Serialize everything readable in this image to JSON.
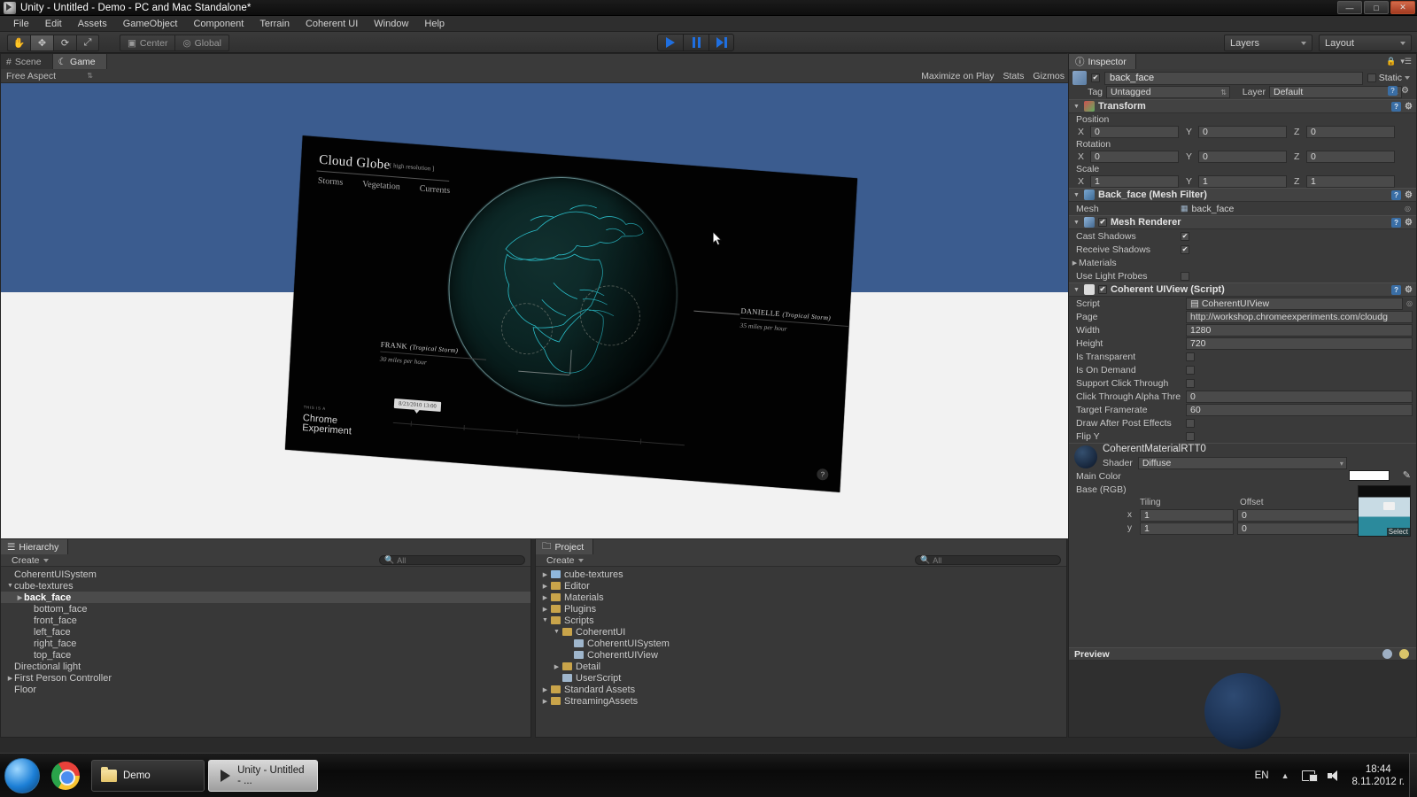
{
  "window": {
    "title": "Unity - Untitled - Demo - PC and Mac Standalone*",
    "minimize": "—",
    "maximize": "□",
    "close": "✕"
  },
  "menu": [
    "File",
    "Edit",
    "Assets",
    "GameObject",
    "Component",
    "Terrain",
    "Coherent UI",
    "Window",
    "Help"
  ],
  "toolbar": {
    "tools": [
      "hand-tool",
      "move-tool",
      "rotate-tool",
      "scale-tool"
    ],
    "pivot": "Center",
    "handle": "Global",
    "play": "play-button",
    "pause": "pause-button",
    "step": "step-button",
    "layers": "Layers",
    "layout": "Layout"
  },
  "gameview": {
    "tabs": [
      {
        "label": "Scene",
        "active": false
      },
      {
        "label": "Game",
        "active": true
      }
    ],
    "aspect": "Free Aspect",
    "maximize_on_play": "Maximize on Play",
    "stats": "Stats",
    "gizmos": "Gizmos"
  },
  "cloudglobe": {
    "title": "Cloud Globe",
    "resolution_tag": "[ high resolution ]",
    "nav": [
      "Storms",
      "Vegetation",
      "Currents"
    ],
    "storms": [
      {
        "name": "DANIELLE",
        "type": "(Tropical Storm)",
        "speed": "35 miles per hour"
      },
      {
        "name": "FRANK",
        "type": "(Tropical Storm)",
        "speed": "30 miles per hour"
      }
    ],
    "timestamp": "8/23/2010 13:00",
    "chrome_small": "THIS IS A",
    "chrome_line1": "Chrome",
    "chrome_line2": "Experiment",
    "help": "?"
  },
  "hierarchy": {
    "tab": "Hierarchy",
    "create": "Create",
    "search_placeholder": "All",
    "items": [
      {
        "label": "CoherentUISystem",
        "depth": 0,
        "arrow": "",
        "selected": false
      },
      {
        "label": "cube-textures",
        "depth": 0,
        "arrow": "▼",
        "selected": false
      },
      {
        "label": "back_face",
        "depth": 1,
        "arrow": "▶",
        "selected": true
      },
      {
        "label": "bottom_face",
        "depth": 2,
        "arrow": "",
        "selected": false
      },
      {
        "label": "front_face",
        "depth": 2,
        "arrow": "",
        "selected": false
      },
      {
        "label": "left_face",
        "depth": 2,
        "arrow": "",
        "selected": false
      },
      {
        "label": "right_face",
        "depth": 2,
        "arrow": "",
        "selected": false
      },
      {
        "label": "top_face",
        "depth": 2,
        "arrow": "",
        "selected": false
      },
      {
        "label": "Directional light",
        "depth": 0,
        "arrow": "",
        "selected": false
      },
      {
        "label": "First Person Controller",
        "depth": 0,
        "arrow": "▶",
        "selected": false
      },
      {
        "label": "Floor",
        "depth": 0,
        "arrow": "",
        "selected": false
      }
    ]
  },
  "project": {
    "tab": "Project",
    "create": "Create",
    "search_placeholder": "All",
    "items": [
      {
        "label": "cube-textures",
        "depth": 0,
        "arrow": "▶",
        "icon": "prefab"
      },
      {
        "label": "Editor",
        "depth": 0,
        "arrow": "▶",
        "icon": "folder"
      },
      {
        "label": "Materials",
        "depth": 0,
        "arrow": "▶",
        "icon": "folder"
      },
      {
        "label": "Plugins",
        "depth": 0,
        "arrow": "▶",
        "icon": "folder"
      },
      {
        "label": "Scripts",
        "depth": 0,
        "arrow": "▼",
        "icon": "folder"
      },
      {
        "label": "CoherentUI",
        "depth": 1,
        "arrow": "▼",
        "icon": "folder"
      },
      {
        "label": "CoherentUISystem",
        "depth": 2,
        "arrow": "",
        "icon": "script"
      },
      {
        "label": "CoherentUIView",
        "depth": 2,
        "arrow": "",
        "icon": "script"
      },
      {
        "label": "Detail",
        "depth": 1,
        "arrow": "▶",
        "icon": "folder"
      },
      {
        "label": "UserScript",
        "depth": 1,
        "arrow": "",
        "icon": "script"
      },
      {
        "label": "Standard Assets",
        "depth": 0,
        "arrow": "▶",
        "icon": "folder"
      },
      {
        "label": "StreamingAssets",
        "depth": 0,
        "arrow": "▶",
        "icon": "folder"
      }
    ]
  },
  "inspector": {
    "tab": "Inspector",
    "object_name": "back_face",
    "static_label": "Static",
    "tag_label": "Tag",
    "tag_value": "Untagged",
    "layer_label": "Layer",
    "layer_value": "Default",
    "transform": {
      "title": "Transform",
      "position_label": "Position",
      "rotation_label": "Rotation",
      "scale_label": "Scale",
      "axes": [
        "X",
        "Y",
        "Z"
      ],
      "position": [
        "0",
        "0",
        "0"
      ],
      "rotation": [
        "0",
        "0",
        "0"
      ],
      "scale": [
        "1",
        "1",
        "1"
      ]
    },
    "mesh_filter": {
      "title": "Back_face (Mesh Filter)",
      "mesh_label": "Mesh",
      "mesh_value": "back_face"
    },
    "mesh_renderer": {
      "title": "Mesh Renderer",
      "cast_shadows_label": "Cast Shadows",
      "cast_shadows": true,
      "receive_shadows_label": "Receive Shadows",
      "receive_shadows": true,
      "materials_label": "Materials",
      "use_light_probes_label": "Use Light Probes",
      "use_light_probes": false
    },
    "uiview": {
      "title": "Coherent UIView (Script)",
      "rows": [
        {
          "label": "Script",
          "value": "CoherentUIView",
          "type": "object"
        },
        {
          "label": "Page",
          "value": "http://workshop.chromeexperiments.com/cloudg",
          "type": "text"
        },
        {
          "label": "Width",
          "value": "1280",
          "type": "text"
        },
        {
          "label": "Height",
          "value": "720",
          "type": "text"
        },
        {
          "label": "Is Transparent",
          "value": "",
          "type": "check",
          "checked": false
        },
        {
          "label": "Is On Demand",
          "value": "",
          "type": "check",
          "checked": false
        },
        {
          "label": "Support Click Through",
          "value": "",
          "type": "check",
          "checked": false
        },
        {
          "label": "Click Through Alpha Thre",
          "value": "0",
          "type": "text"
        },
        {
          "label": "Target Framerate",
          "value": "60",
          "type": "text"
        },
        {
          "label": "Draw After Post Effects",
          "value": "",
          "type": "check",
          "checked": false
        },
        {
          "label": "Flip Y",
          "value": "",
          "type": "check",
          "checked": false
        }
      ]
    },
    "material": {
      "name": "CoherentMaterialRTT0",
      "shader_label": "Shader",
      "shader_value": "Diffuse",
      "main_color_label": "Main Color",
      "main_color_hex": "#ffffff",
      "base_rgb_label": "Base (RGB)",
      "tiling_label": "Tiling",
      "offset_label": "Offset",
      "rows": [
        {
          "axis": "x",
          "tiling": "1",
          "offset": "0"
        },
        {
          "axis": "y",
          "tiling": "1",
          "offset": "0"
        }
      ],
      "select_label": "Select"
    },
    "preview": {
      "title": "Preview"
    }
  },
  "taskbar": {
    "items": [
      {
        "label": "Demo",
        "icon": "folder-icon",
        "active": false
      },
      {
        "label": "Unity - Untitled - ...",
        "icon": "unity-icon",
        "active": true
      }
    ],
    "language": "EN",
    "time": "18:44",
    "date": "8.11.2012 г."
  }
}
